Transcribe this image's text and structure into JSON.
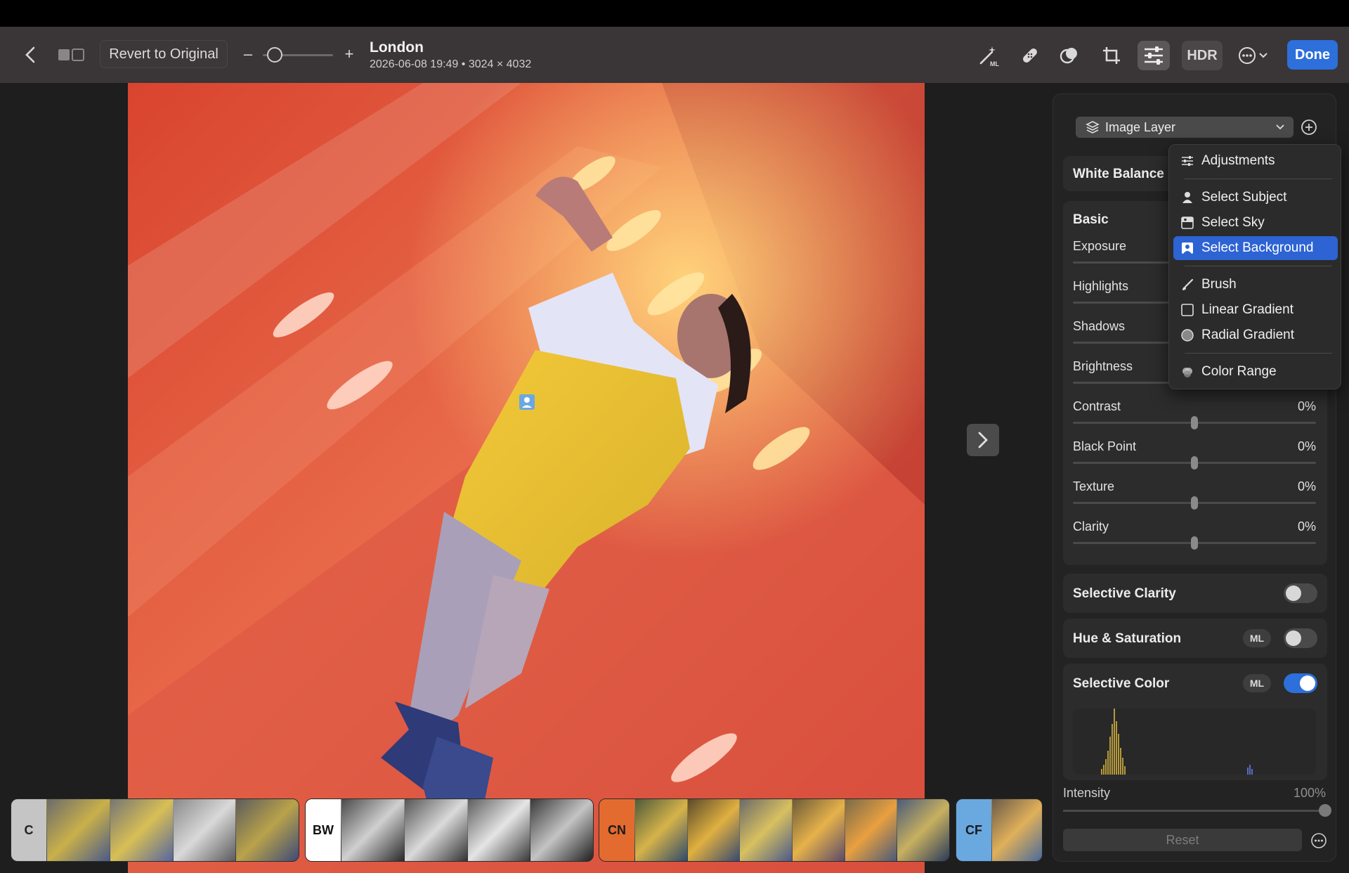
{
  "toolbar": {
    "revert_label": "Revert to Original",
    "zoom_minus": "–",
    "zoom_plus": "+",
    "title": "London",
    "subtitle": "2026-06-08 19:49 • 3024 × 4032",
    "hdr_label": "HDR",
    "done_label": "Done"
  },
  "filmstrip": {
    "groups": [
      {
        "label": "C",
        "label_bg": "#c5c5c5",
        "label_color": "#222222"
      },
      {
        "label": "BW",
        "label_bg": "#ffffff",
        "label_color": "#111111"
      },
      {
        "label": "CN",
        "label_bg": "#e36b2f",
        "label_color": "#1a1a1a"
      },
      {
        "label": "CF",
        "label_bg": "#6aa8e0",
        "label_color": "#1a1a1a"
      }
    ]
  },
  "panel": {
    "layer_label": "Image Layer",
    "white_balance": "White Balance",
    "basic": "Basic",
    "sliders": [
      {
        "label": "Exposure",
        "value": ""
      },
      {
        "label": "Highlights",
        "value": ""
      },
      {
        "label": "Shadows",
        "value": ""
      },
      {
        "label": "Brightness",
        "value": ""
      },
      {
        "label": "Contrast",
        "value": "0%"
      },
      {
        "label": "Black Point",
        "value": "0%"
      },
      {
        "label": "Texture",
        "value": "0%"
      },
      {
        "label": "Clarity",
        "value": "0%"
      }
    ],
    "selective_clarity": "Selective Clarity",
    "hue_saturation": "Hue & Saturation",
    "selective_color": "Selective Color",
    "ml_badge": "ML",
    "intensity_label": "Intensity",
    "intensity_value": "100%",
    "reset_label": "Reset"
  },
  "dropdown": {
    "items": [
      {
        "label": "Adjustments",
        "icon": "sliders-icon"
      },
      {
        "label": "Select Subject",
        "icon": "person-icon"
      },
      {
        "label": "Select Sky",
        "icon": "sky-icon"
      },
      {
        "label": "Select Background",
        "icon": "background-icon",
        "selected": true
      },
      {
        "label": "Brush",
        "icon": "brush-icon"
      },
      {
        "label": "Linear Gradient",
        "icon": "linear-gradient-icon"
      },
      {
        "label": "Radial Gradient",
        "icon": "radial-gradient-icon"
      },
      {
        "label": "Color Range",
        "icon": "color-range-icon"
      }
    ]
  },
  "colors": {
    "accent": "#2d6fdb",
    "toolbar_bg": "#3a3536",
    "panel_bg": "#232323"
  }
}
